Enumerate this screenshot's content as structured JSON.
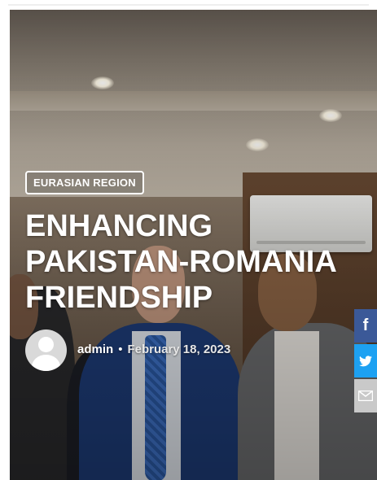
{
  "article": {
    "category": "EURASIAN REGION",
    "title": "ENHANCING PAKISTAN-ROMANIA FRIENDSHIP",
    "author": "admin",
    "separator": "•",
    "date": "February 18, 2023"
  },
  "share": {
    "facebook_glyph": "f"
  },
  "colors": {
    "facebook": "#3b5998",
    "twitter": "#1da1f2",
    "email": "#c9c9c9"
  },
  "icons": [
    "user-avatar-icon",
    "facebook-icon",
    "twitter-icon",
    "email-icon"
  ]
}
